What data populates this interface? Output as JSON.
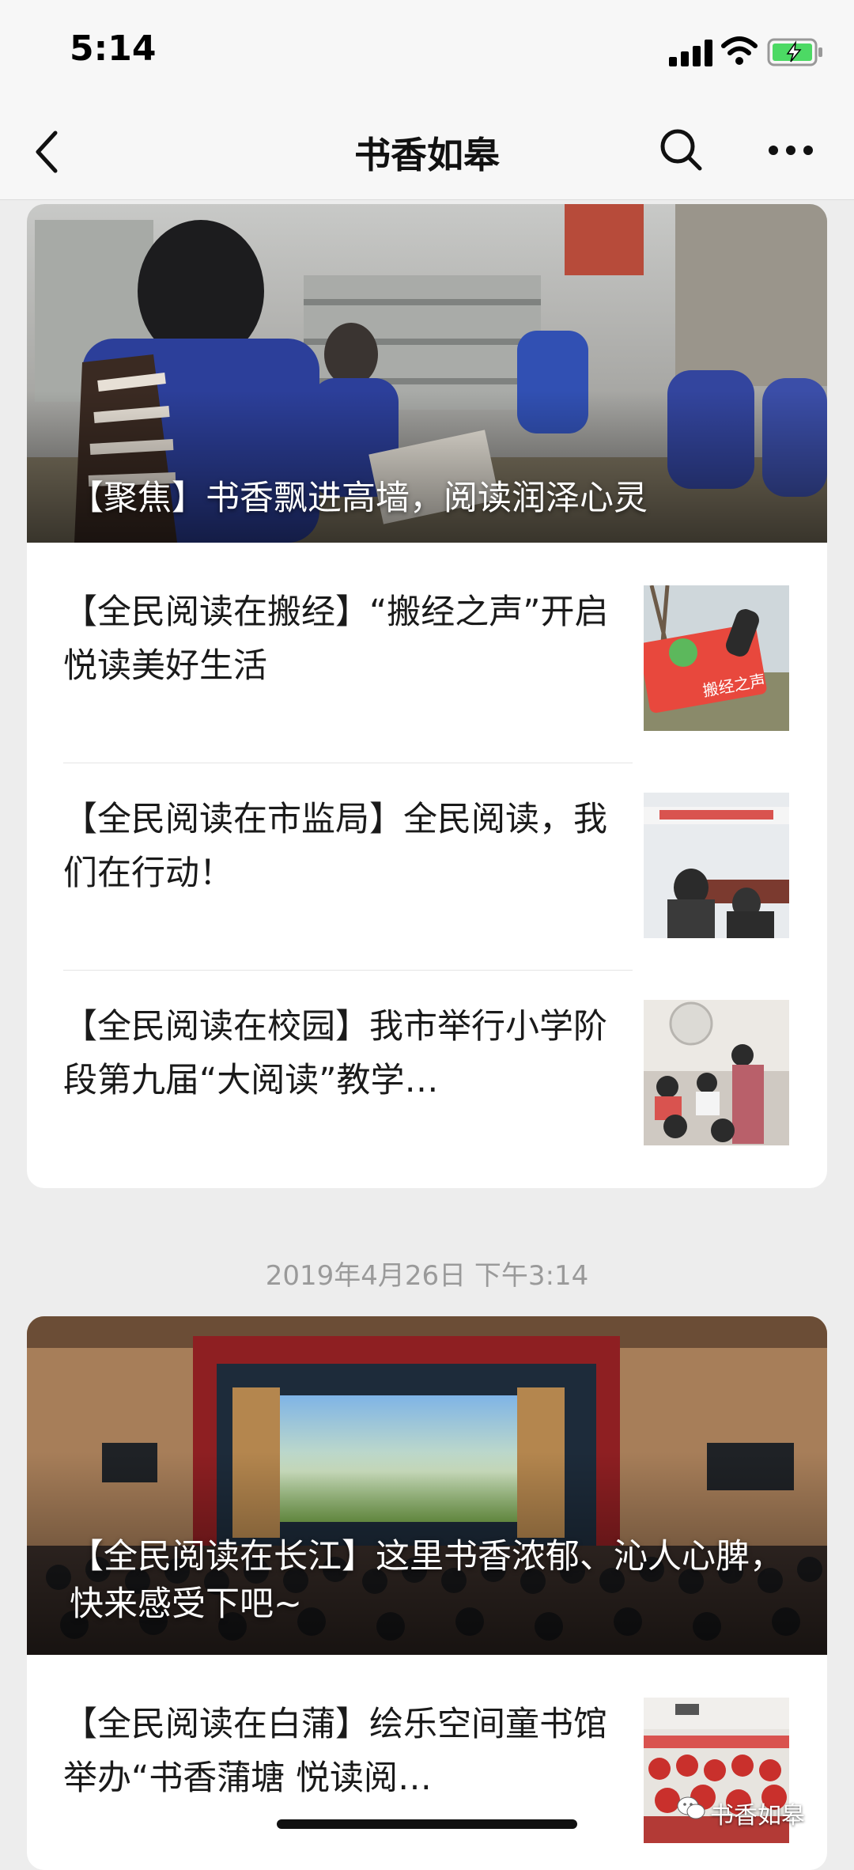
{
  "status_bar": {
    "time": "5:14"
  },
  "nav": {
    "title": "书香如皋"
  },
  "card1": {
    "hero_title": "【聚焦】书香飘进高墙，阅读润泽心灵",
    "items": [
      {
        "title": "【全民阅读在搬经】“搬经之声”开启悦读美好生活",
        "thumb_text": "搬经之声"
      },
      {
        "title": "【全民阅读在市监局】全民阅读，我们在行动！"
      },
      {
        "title": "【全民阅读在校园】我市举行小学阶段第九届“大阅读”教学…"
      }
    ]
  },
  "timestamp": "2019年4月26日  下午3:14",
  "card2": {
    "hero_title": "【全民阅读在长江】这里书香浓郁、沁人心脾，快来感受下吧~",
    "items": [
      {
        "title": "【全民阅读在白蒲】绘乐空间童书馆举办“书香蒲塘  悦读阅…"
      }
    ]
  },
  "watermark": "书香如皋",
  "colors": {
    "background": "#ededed",
    "card": "#ffffff",
    "timestamp": "#9a9a9a",
    "battery": "#4cd964"
  }
}
